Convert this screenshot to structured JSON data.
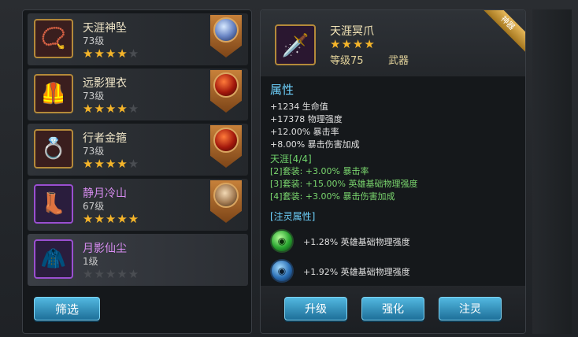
{
  "items": [
    {
      "name": "天涯神坠",
      "level": "73级",
      "stars": 4,
      "icon": "pendant-icon",
      "gem": "blue"
    },
    {
      "name": "远影狸衣",
      "level": "73级",
      "stars": 4,
      "icon": "armor-icon",
      "gem": "red"
    },
    {
      "name": "行者金箍",
      "level": "73级",
      "stars": 4,
      "icon": "ring-icon",
      "gem": "red"
    },
    {
      "name": "静月冷山",
      "level": "67级",
      "stars": 5,
      "icon": "boots-icon",
      "gem": "face"
    },
    {
      "name": "月影仙尘",
      "level": "1级",
      "stars": 0,
      "icon": "cloak-icon",
      "gem": ""
    }
  ],
  "filter_label": "筛选",
  "detail": {
    "ribbon": "神器",
    "name": "天涯冥爪",
    "stars": 4,
    "level": "等级75",
    "type": "武器",
    "attr_title": "属性",
    "attrs": [
      "+1234 生命值",
      "+17378 物理强度",
      "+12.00% 暴击率",
      "+8.00% 暴击伤害加成"
    ],
    "set_title": "天涯[4/4]",
    "set_lines": [
      "[2]套装: +3.00% 暴击率",
      "[3]套装: +15.00% 英雄基础物理强度",
      "[4]套装: +3.00% 暴击伤害加成"
    ],
    "infuse_title": "[注灵属性]",
    "infuse": [
      {
        "text": "+1.28% 英雄基础物理强度"
      },
      {
        "text": "+1.92% 英雄基础物理强度"
      }
    ]
  },
  "actions": {
    "upgrade": "升级",
    "enhance": "强化",
    "infuse": "注灵"
  },
  "colors": {
    "accent_blue": "#52b8e0",
    "star_gold": "#f5b52a",
    "set_green": "#7ad66e"
  }
}
